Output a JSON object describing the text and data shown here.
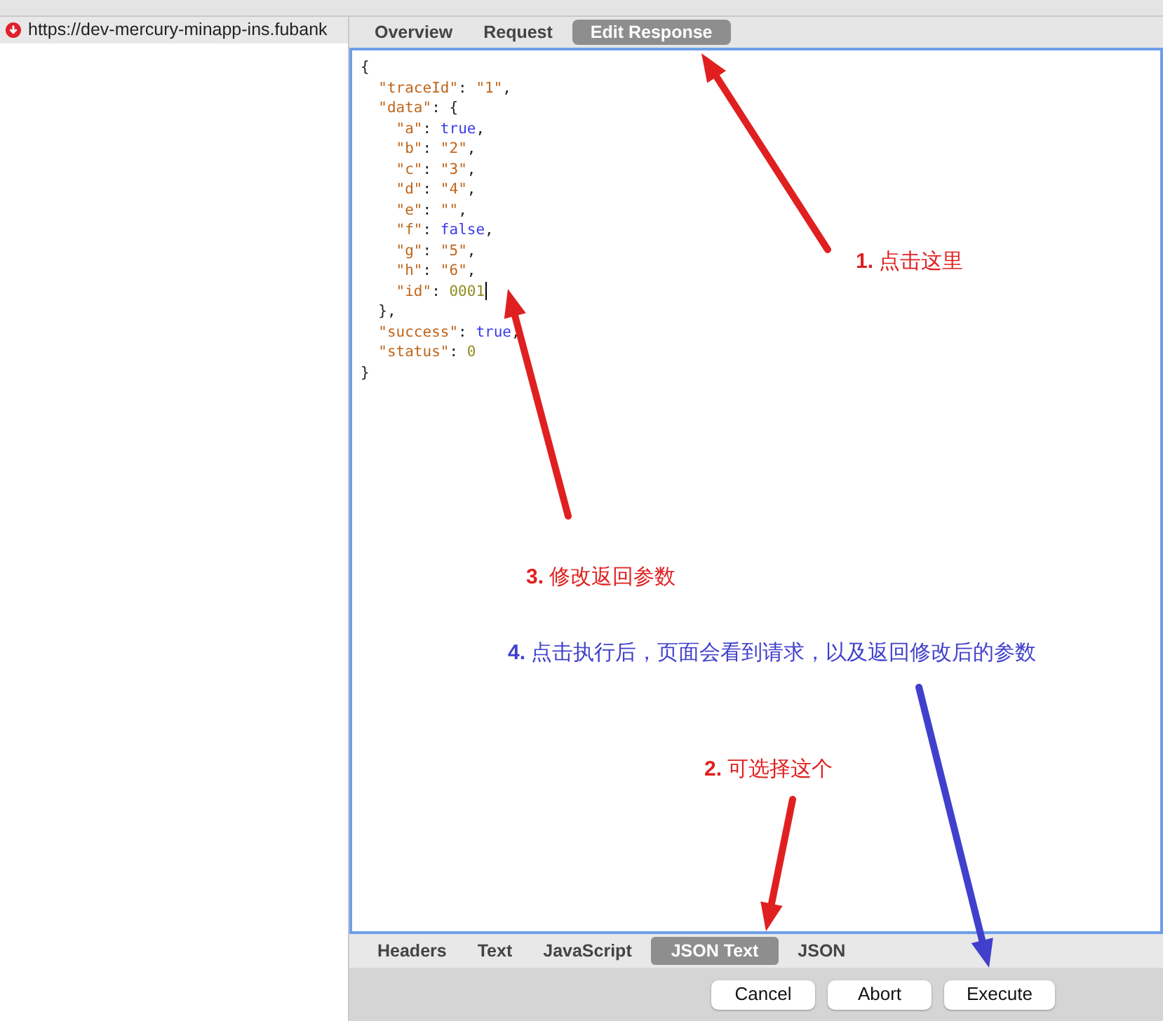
{
  "request_list": [
    {
      "url": "https://dev-mercury-minapp-ins.fubank"
    }
  ],
  "top_tabs": [
    {
      "label": "Overview",
      "selected": false
    },
    {
      "label": "Request",
      "selected": false
    },
    {
      "label": "Edit Response",
      "selected": true
    }
  ],
  "editor": {
    "lines": [
      {
        "tokens": [
          {
            "kind": "punct",
            "text": "{"
          }
        ]
      },
      {
        "tokens": [
          {
            "kind": "key",
            "text": "  \"traceId\""
          },
          {
            "kind": "punct",
            "text": ": "
          },
          {
            "kind": "string",
            "text": "\"1\""
          },
          {
            "kind": "punct",
            "text": ","
          }
        ]
      },
      {
        "tokens": [
          {
            "kind": "key",
            "text": "  \"data\""
          },
          {
            "kind": "punct",
            "text": ": {"
          }
        ]
      },
      {
        "tokens": [
          {
            "kind": "key",
            "text": "    \"a\""
          },
          {
            "kind": "punct",
            "text": ": "
          },
          {
            "kind": "keyword",
            "text": "true"
          },
          {
            "kind": "punct",
            "text": ","
          }
        ]
      },
      {
        "tokens": [
          {
            "kind": "key",
            "text": "    \"b\""
          },
          {
            "kind": "punct",
            "text": ": "
          },
          {
            "kind": "string",
            "text": "\"2\""
          },
          {
            "kind": "punct",
            "text": ","
          }
        ]
      },
      {
        "tokens": [
          {
            "kind": "key",
            "text": "    \"c\""
          },
          {
            "kind": "punct",
            "text": ": "
          },
          {
            "kind": "string",
            "text": "\"3\""
          },
          {
            "kind": "punct",
            "text": ","
          }
        ]
      },
      {
        "tokens": [
          {
            "kind": "key",
            "text": "    \"d\""
          },
          {
            "kind": "punct",
            "text": ": "
          },
          {
            "kind": "string",
            "text": "\"4\""
          },
          {
            "kind": "punct",
            "text": ","
          }
        ]
      },
      {
        "tokens": [
          {
            "kind": "key",
            "text": "    \"e\""
          },
          {
            "kind": "punct",
            "text": ": "
          },
          {
            "kind": "string",
            "text": "\"\""
          },
          {
            "kind": "punct",
            "text": ","
          }
        ]
      },
      {
        "tokens": [
          {
            "kind": "key",
            "text": "    \"f\""
          },
          {
            "kind": "punct",
            "text": ": "
          },
          {
            "kind": "keyword",
            "text": "false"
          },
          {
            "kind": "punct",
            "text": ","
          }
        ]
      },
      {
        "tokens": [
          {
            "kind": "key",
            "text": "    \"g\""
          },
          {
            "kind": "punct",
            "text": ": "
          },
          {
            "kind": "string",
            "text": "\"5\""
          },
          {
            "kind": "punct",
            "text": ","
          }
        ]
      },
      {
        "tokens": [
          {
            "kind": "key",
            "text": "    \"h\""
          },
          {
            "kind": "punct",
            "text": ": "
          },
          {
            "kind": "string",
            "text": "\"6\""
          },
          {
            "kind": "punct",
            "text": ","
          }
        ]
      },
      {
        "tokens": [
          {
            "kind": "key",
            "text": "    \"id\""
          },
          {
            "kind": "punct",
            "text": ": "
          },
          {
            "kind": "number",
            "text": "0001"
          }
        ],
        "cursor": true
      },
      {
        "tokens": [
          {
            "kind": "punct",
            "text": "  },"
          }
        ]
      },
      {
        "tokens": [
          {
            "kind": "key",
            "text": "  \"success\""
          },
          {
            "kind": "punct",
            "text": ": "
          },
          {
            "kind": "keyword",
            "text": "true"
          },
          {
            "kind": "punct",
            "text": ","
          }
        ]
      },
      {
        "tokens": [
          {
            "kind": "key",
            "text": "  \"status\""
          },
          {
            "kind": "punct",
            "text": ": "
          },
          {
            "kind": "number",
            "text": "0"
          }
        ]
      },
      {
        "tokens": [
          {
            "kind": "punct",
            "text": "}"
          }
        ]
      }
    ]
  },
  "bottom_tabs": [
    {
      "label": "Headers",
      "selected": false
    },
    {
      "label": "Text",
      "selected": false
    },
    {
      "label": "JavaScript",
      "selected": false
    },
    {
      "label": "JSON Text",
      "selected": true
    },
    {
      "label": "JSON",
      "selected": false
    }
  ],
  "buttons": [
    "Cancel",
    "Abort",
    "Execute"
  ],
  "annotations": [
    {
      "text": "**1.** 点击这里",
      "color": "#e02020"
    },
    {
      "text": "**3.** 修改返回参数",
      "color": "#e02020"
    },
    {
      "text": "**4.** 点击执行后，页面会看到请求，以及返回修改后的参数",
      "color": "#4040cc"
    },
    {
      "text": "**2.** 可选择这个",
      "color": "#e02020"
    }
  ]
}
